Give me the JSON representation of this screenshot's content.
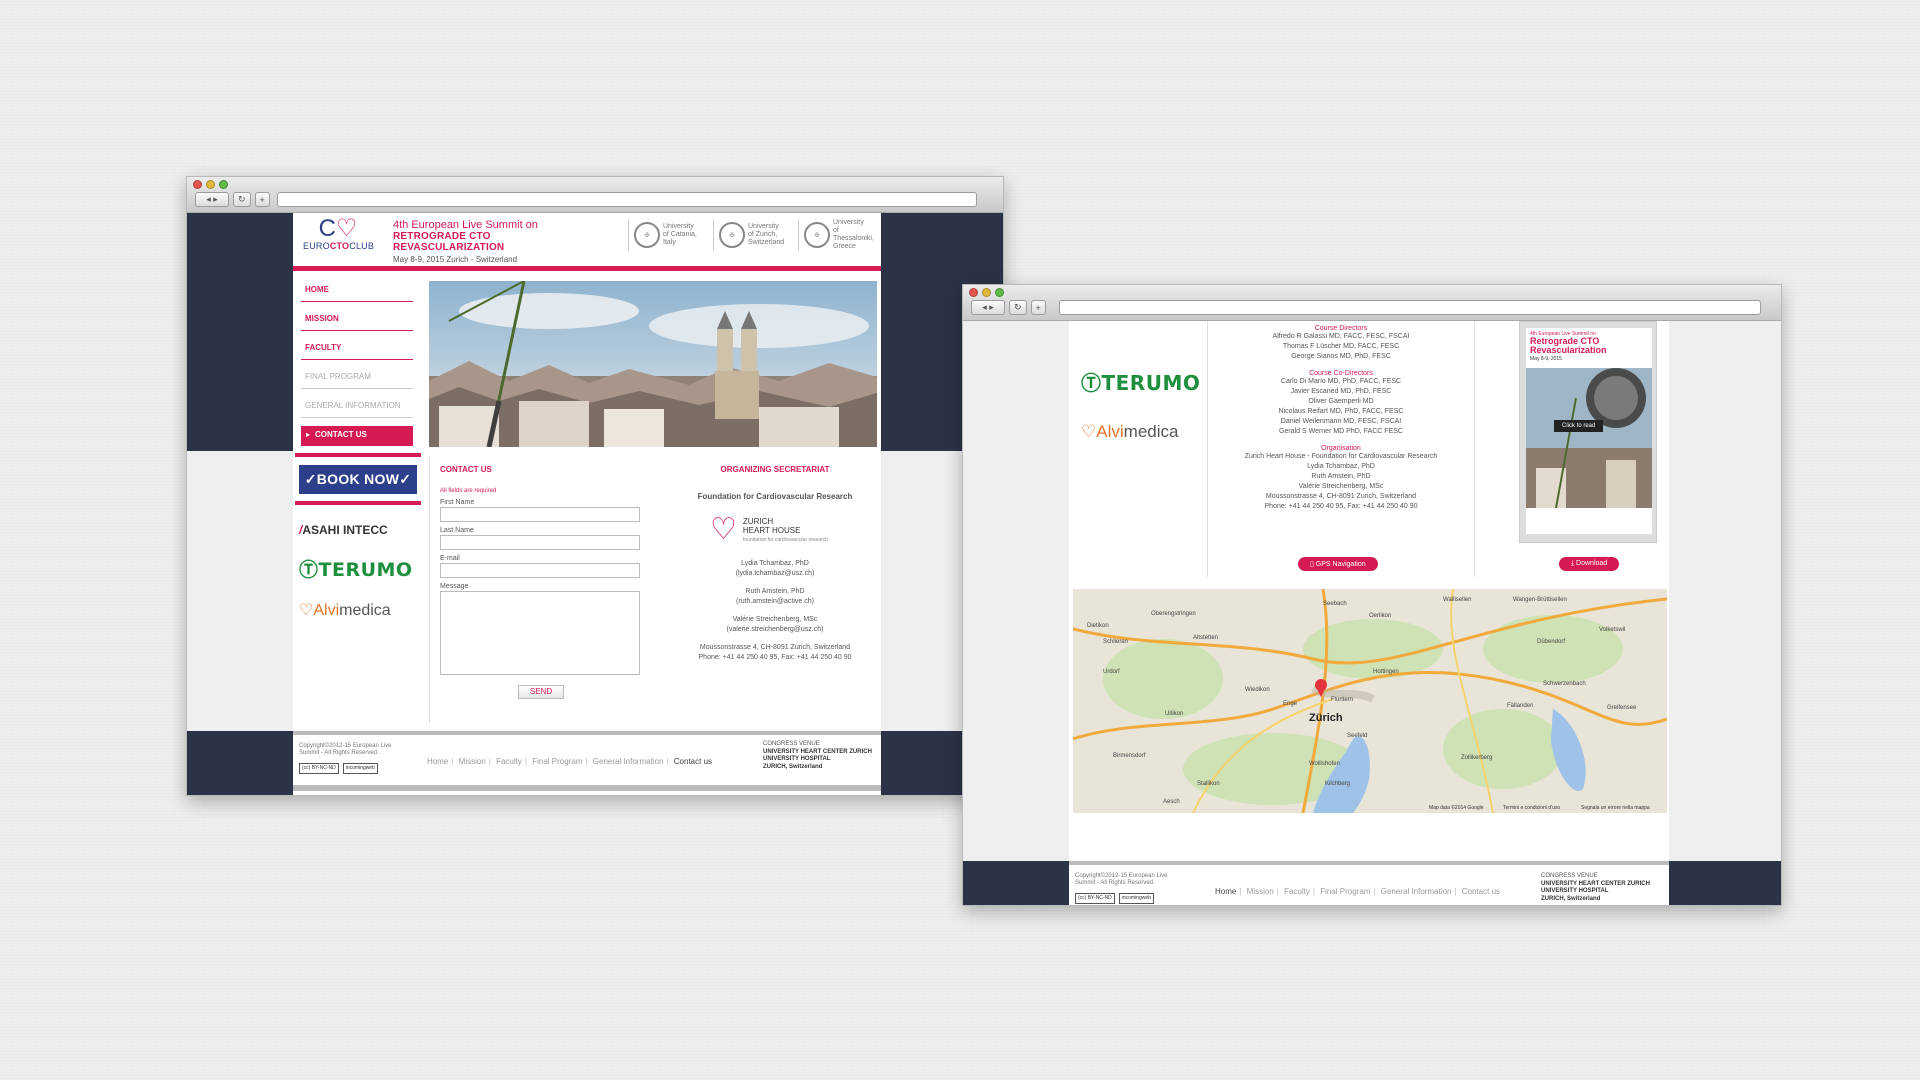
{
  "browser1": {
    "header": {
      "logo_text_a": "EURO",
      "logo_text_b": "CTO",
      "logo_text_c": "CLUB",
      "summit_line1": "4th European Live Summit on",
      "summit_line2": "RETROGRADE CTO REVASCULARIZATION",
      "summit_line3": "May 8-9, 2015    Zurich - Switzerland",
      "universities": [
        {
          "line1": "University",
          "line2": "of Catania,",
          "line3": "Italy"
        },
        {
          "line1": "University",
          "line2": "of Zurich,",
          "line3": "Switzerland"
        },
        {
          "line1": "University",
          "line2": "of Thessaloniki,",
          "line3": "Greece"
        }
      ]
    },
    "nav": [
      "HOME",
      "MISSION",
      "FACULTY",
      "FINAL PROGRAM",
      "GENERAL INFORMATION",
      "CONTACT US"
    ],
    "book_now": "✓BOOK NOW✓",
    "sponsors": {
      "asahi_a": "/",
      "asahi_b": "ASAHI INTECC",
      "terumo": "TERUMO",
      "alvi_a": "Alvi",
      "alvi_b": "medica"
    },
    "form": {
      "title": "CONTACT US",
      "required": "All fields are required",
      "first_name": "First Name",
      "last_name": "Last Name",
      "email": "E-mail",
      "message": "Message",
      "send": "SEND"
    },
    "secretariat": {
      "title": "ORGANIZING SECRETARIAT",
      "foundation": "Foundation for Cardiovascular Research",
      "zhh_line1": "ZURICH",
      "zhh_line2": "HEART HOUSE",
      "zhh_small": "foundation for cardiovascular research",
      "persons": [
        {
          "name": "Lydia Tchambaz, PhD",
          "email": "(lydia.tchambaz@usz.ch)"
        },
        {
          "name": "Ruth Amstein, PhD",
          "email": "(ruth.amstein@active.ch)"
        },
        {
          "name": "Valérie Streichenberg, MSc",
          "email": "(valerie.streichenberg@usz.ch)"
        }
      ],
      "address": "Moussonstrasse 4, CH-8091 Zurich, Switzerland",
      "phone": "Phone: +41 44 250 40 95, Fax: +41 44 250 40 90"
    },
    "footer": {
      "copyright": "Copyright©2012-15 European Live Summit - All Rights Reserved.",
      "cc1": "(cc) BY-NC-ND",
      "cc2": "incomingweb",
      "links": [
        "Home",
        "Mission",
        "Faculty",
        "Final Program",
        "General Information",
        "Contact us"
      ],
      "venue_label": "CONGRESS VENUE",
      "venue_1": "UNIVERSITY HEART CENTER ZURICH",
      "venue_2": "UNIVERSITY HOSPITAL",
      "venue_3": "ZURICH, Switzerland"
    }
  },
  "browser2": {
    "sponsors": {
      "terumo": "TERUMO",
      "alvi_a": "Alvi",
      "alvi_b": "medica"
    },
    "faculty": {
      "groups": [
        {
          "heading": "Course Directors",
          "names": [
            "Alfredo R Galassi MD, FACC, FESC, FSCAI",
            "Thomas F Lüscher MD, FACC, FESC",
            "George Sianos MD, PhD, FESC"
          ]
        },
        {
          "heading": "Course Co-Directors",
          "names": [
            "Carlo Di Mario MD, PhD, FACC, FESC",
            "Javier Escaned MD, PhD, FESC",
            "Oliver Gaemperli MD",
            "Nicolaus Reifart MD, PhD, FACC, FESC",
            "Daniel Weilenmann MD, FESC, FSCAI",
            "Gerald S Werner MD PhD, FACC FESC"
          ]
        },
        {
          "heading": "Organisation",
          "names": [
            "Zurich Heart House - Foundation for Cardiovascular Research",
            "Lydia Tchambaz, PhD",
            "Ruth Amstein, PhD",
            "Valérie Streichenberg, MSc",
            "Moussonstrasse 4, CH-8091 Zurich, Switzerland",
            "Phone: +41 44 250 40 95, Fax: +41 44 250 40 90"
          ]
        }
      ],
      "gps_button": "GPS Navigation"
    },
    "poster": {
      "line1": "4th European Live Summit on",
      "line2": "Retrograde CTO",
      "line3": "Revascularization",
      "date": "May 8-9, 2015",
      "click": "Click to read",
      "download": "Download"
    },
    "map": {
      "city": "Zürich",
      "places": [
        "Wallisellen",
        "Dietikon",
        "Oberengstringen",
        "Schlieren",
        "Urdorf",
        "Altstetten",
        "Uitikon",
        "Birmensdorf",
        "Dübendorf",
        "Volketswil",
        "Schwerzenbach",
        "Fällanden",
        "Greifensee",
        "Zollikerberg",
        "Aesch",
        "Stallikon",
        "Kilchberg",
        "Oerlikon",
        "Seebach",
        "Wangen-Brüttisellen",
        "Hottingen",
        "Enge",
        "Wollishofen",
        "Seefeld",
        "Fluntern",
        "Wiedikon"
      ],
      "attribution": "Map data ©2014 Google",
      "terms": "Termini e condizioni d'uso",
      "report": "Segnala un errore nella mappa"
    },
    "footer": {
      "copyright": "Copyright©2012-15 European Live Summit - All Rights Reserved.",
      "cc1": "(cc) BY-NC-ND",
      "cc2": "incomingweb",
      "links": [
        "Home",
        "Mission",
        "Faculty",
        "Final Program",
        "General Information",
        "Contact us"
      ],
      "venue_label": "CONGRESS VENUE",
      "venue_1": "UNIVERSITY HEART CENTER ZURICH",
      "venue_2": "UNIVERSITY HOSPITAL",
      "venue_3": "ZURICH, Switzerland"
    }
  },
  "colors": {
    "accent": "#d51a54",
    "navy": "#2c3347",
    "terumo_green": "#1e8f3d",
    "alvi_orange": "#e67324"
  }
}
